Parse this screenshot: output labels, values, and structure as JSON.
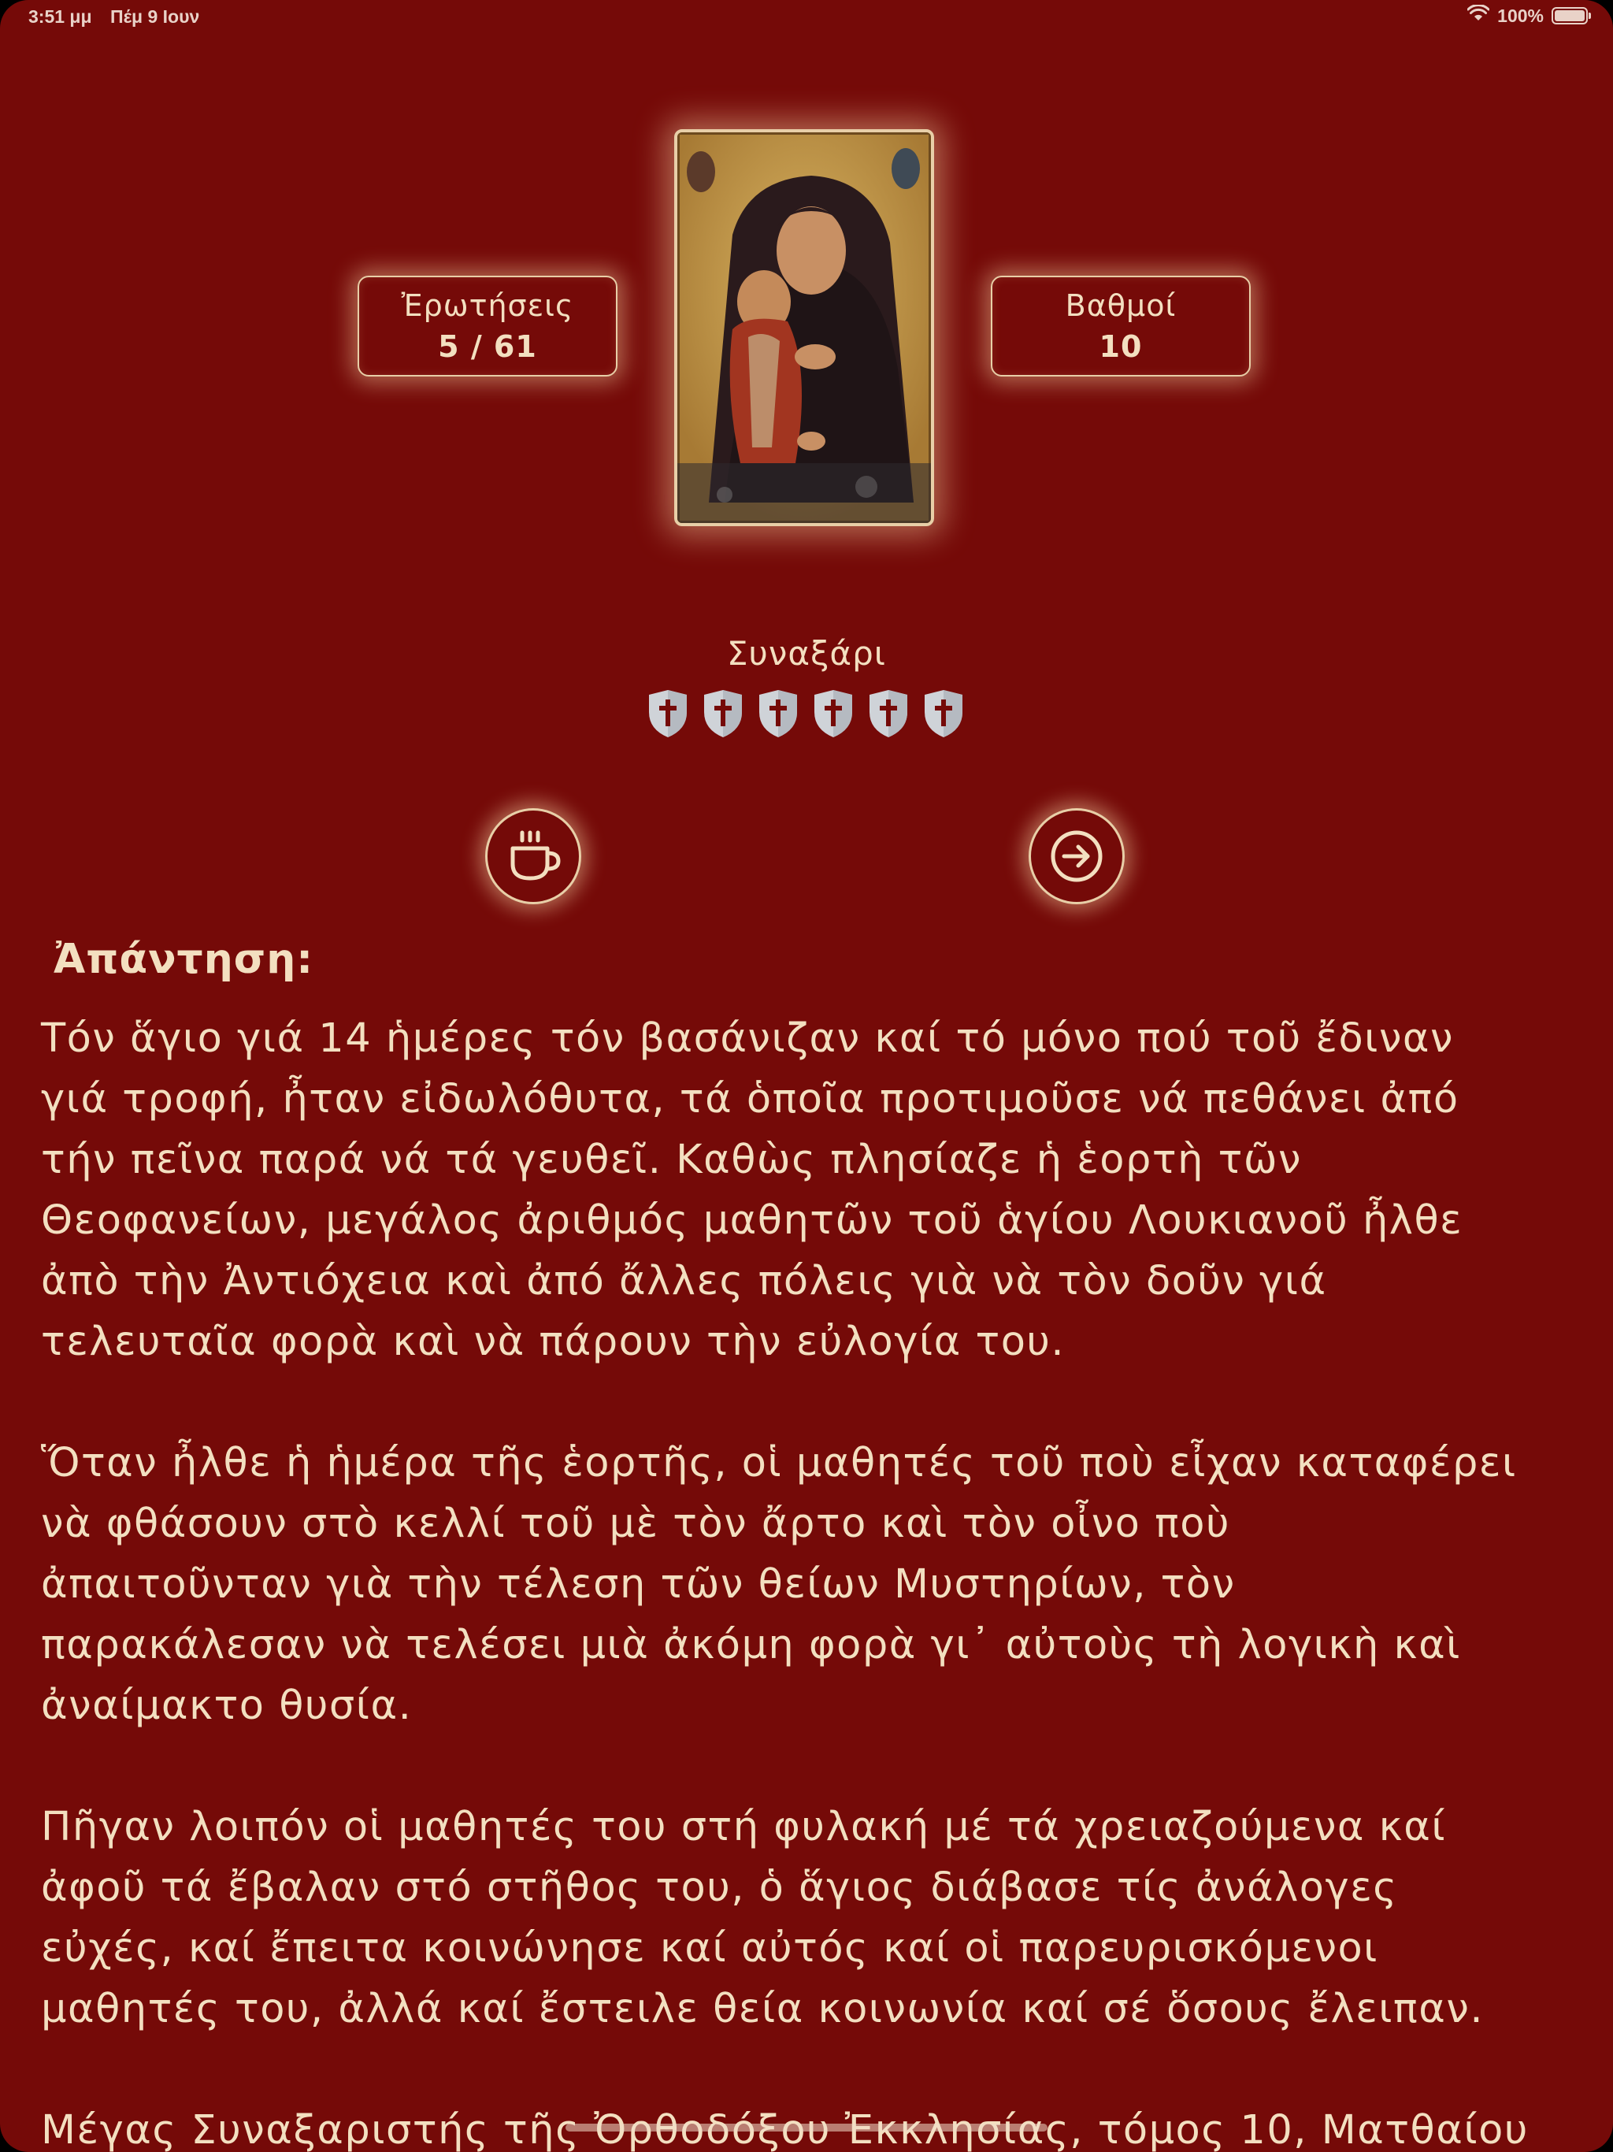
{
  "status_bar": {
    "time": "3:51 μμ",
    "date": "Πέμ 9 Ιουν",
    "battery_text": "100%"
  },
  "header": {
    "questions_label": "Ἐρωτήσεις",
    "questions_value": "5 / 61",
    "points_label": "Βαθμοί",
    "points_value": "10"
  },
  "category": {
    "title": "Συναξάρι",
    "difficulty_icons": [
      "cross-shield-icon",
      "cross-shield-icon",
      "cross-shield-icon",
      "cross-shield-icon",
      "cross-shield-icon",
      "cross-shield-icon"
    ]
  },
  "buttons": {
    "coffee_icon": "coffee-cup-icon",
    "next_icon": "arrow-right-circle-icon"
  },
  "answer": {
    "heading": "Ἀπάντηση:",
    "paragraphs": [
      [
        "Τόν ἅγιο γιά 14 ἡμέρες τόν βασάνιζαν καί τό μόνο πού τοῦ ἔδιναν",
        "γιά τροφή, ἦταν εἰδωλόθυτα, τά ὁποῖα προτιμοῦσε νά πεθάνει ἀπό",
        "τήν πεῖνα παρά νά τά γευθεῖ. Καθὼς πλησίαζε ἡ ἑορτὴ τῶν",
        "Θεοφανείων, μεγάλος ἀριθμός μαθητῶν τοῦ ἁγίου Λουκιανοῦ ἦλθε",
        "ἀπὸ τὴν Ἀντιόχεια καὶ ἀπό ἄλλες πόλεις γιὰ νὰ τὸν δοῦν γιά",
        "τελευταῖα φορὰ καὶ νὰ πάρουν τὴν εὐλογία του."
      ],
      [
        "Ὅταν ἦλθε ἡ ἡμέρα τῆς ἑορτῆς, οἱ μαθητές τοῦ ποὺ εἶχαν καταφέρει",
        "νὰ φθάσουν στὸ κελλί τοῦ μὲ τὸν ἄρτο καὶ τὸν οἶνο ποὺ",
        "ἀπαιτοῦνταν γιὰ τὴν τέλεση τῶν θείων Μυστηρίων, τὸν",
        "παρακάλεσαν νὰ τελέσει μιὰ ἀκόμη φορὰ γι᾽ αὐτοὺς τὴ λογικὴ καὶ",
        "ἀναίμακτο θυσία."
      ],
      [
        "Πῆγαν λοιπόν οἱ μαθητές του στή φυλακή μέ τά χρειαζούμενα καί",
        "ἀφοῦ τά ἔβαλαν στό στῆθος του, ὁ ἅγιος διάβασε τίς ἀνάλογες",
        "εὐχές, καί ἔπειτα κοινώνησε καί  αὐτός καί οἱ παρευρισκόμενοι",
        "μαθητές του, ἀλλά καί ἔστειλε θεία κοινωνία καί σέ ὅσους ἔλειπαν."
      ],
      [
        "Μέγας Συναξαριστής τῆς Ὀρθοδόξου Ἐκκλησίας, τόμος 10, Ματθαίου"
      ]
    ]
  }
}
